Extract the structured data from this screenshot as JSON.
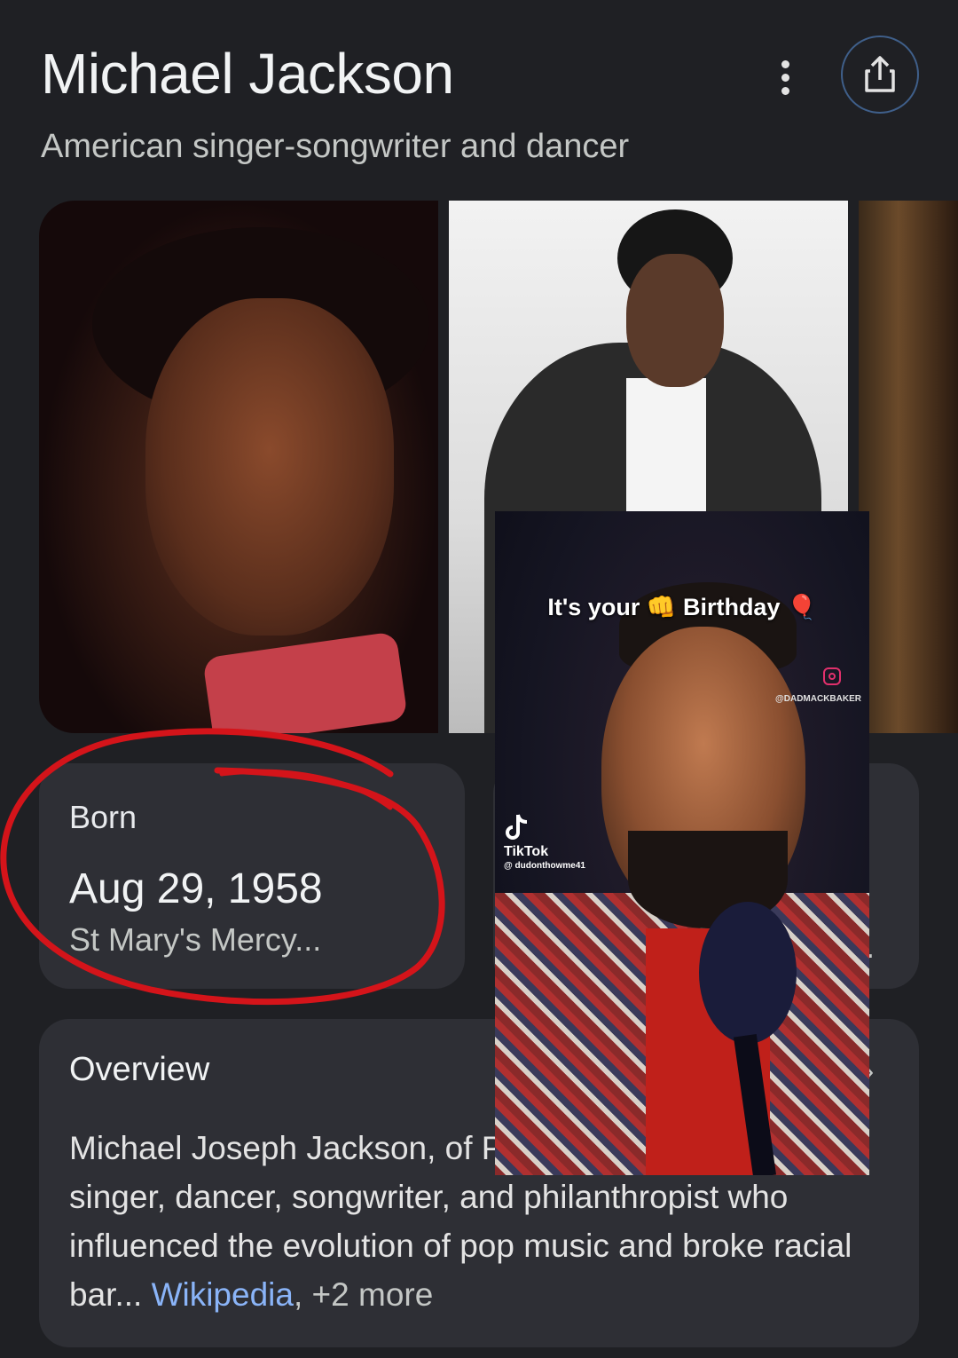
{
  "header": {
    "title": "Michael Jackson",
    "subtitle": "American singer-songwriter and dancer"
  },
  "born": {
    "label": "Born",
    "date": "Aug 29, 1958",
    "place": "St Mary's Mercy..."
  },
  "second_card": {
    "trailing": "."
  },
  "overview": {
    "title": "Overview",
    "text_line1": "Michael Joseph Jackson, of",
    "text_rest": "Pop\", was an American singer, dancer, songwriter, and philanthropist who influenced the evolution of pop music and broke racial bar",
    "ellipsis": "...",
    "source": "Wikipedia",
    "more": ", +2 more"
  },
  "tiktok_overlay": {
    "caption": "It's your 👊 Birthday 🎈",
    "handle": "@DADMACKBAKER",
    "logo": "TikTok",
    "user": "@ dudonthowme41"
  },
  "colors": {
    "background": "#1f2024",
    "card": "#2e2f35",
    "link": "#8ab4f8",
    "annotation": "#d4141a"
  }
}
